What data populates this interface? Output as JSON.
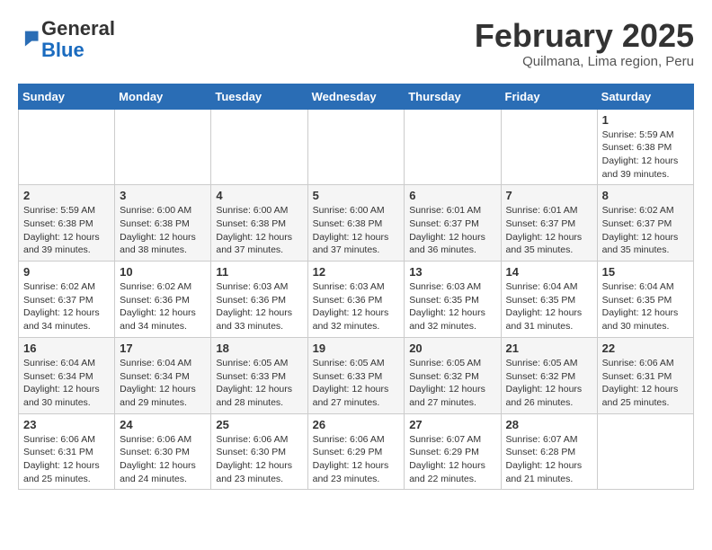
{
  "logo": {
    "general": "General",
    "blue": "Blue"
  },
  "header": {
    "month": "February 2025",
    "location": "Quilmana, Lima region, Peru"
  },
  "weekdays": [
    "Sunday",
    "Monday",
    "Tuesday",
    "Wednesday",
    "Thursday",
    "Friday",
    "Saturday"
  ],
  "weeks": [
    [
      {
        "day": "",
        "info": ""
      },
      {
        "day": "",
        "info": ""
      },
      {
        "day": "",
        "info": ""
      },
      {
        "day": "",
        "info": ""
      },
      {
        "day": "",
        "info": ""
      },
      {
        "day": "",
        "info": ""
      },
      {
        "day": "1",
        "info": "Sunrise: 5:59 AM\nSunset: 6:38 PM\nDaylight: 12 hours and 39 minutes."
      }
    ],
    [
      {
        "day": "2",
        "info": "Sunrise: 5:59 AM\nSunset: 6:38 PM\nDaylight: 12 hours and 39 minutes."
      },
      {
        "day": "3",
        "info": "Sunrise: 6:00 AM\nSunset: 6:38 PM\nDaylight: 12 hours and 38 minutes."
      },
      {
        "day": "4",
        "info": "Sunrise: 6:00 AM\nSunset: 6:38 PM\nDaylight: 12 hours and 37 minutes."
      },
      {
        "day": "5",
        "info": "Sunrise: 6:00 AM\nSunset: 6:38 PM\nDaylight: 12 hours and 37 minutes."
      },
      {
        "day": "6",
        "info": "Sunrise: 6:01 AM\nSunset: 6:37 PM\nDaylight: 12 hours and 36 minutes."
      },
      {
        "day": "7",
        "info": "Sunrise: 6:01 AM\nSunset: 6:37 PM\nDaylight: 12 hours and 35 minutes."
      },
      {
        "day": "8",
        "info": "Sunrise: 6:02 AM\nSunset: 6:37 PM\nDaylight: 12 hours and 35 minutes."
      }
    ],
    [
      {
        "day": "9",
        "info": "Sunrise: 6:02 AM\nSunset: 6:37 PM\nDaylight: 12 hours and 34 minutes."
      },
      {
        "day": "10",
        "info": "Sunrise: 6:02 AM\nSunset: 6:36 PM\nDaylight: 12 hours and 34 minutes."
      },
      {
        "day": "11",
        "info": "Sunrise: 6:03 AM\nSunset: 6:36 PM\nDaylight: 12 hours and 33 minutes."
      },
      {
        "day": "12",
        "info": "Sunrise: 6:03 AM\nSunset: 6:36 PM\nDaylight: 12 hours and 32 minutes."
      },
      {
        "day": "13",
        "info": "Sunrise: 6:03 AM\nSunset: 6:35 PM\nDaylight: 12 hours and 32 minutes."
      },
      {
        "day": "14",
        "info": "Sunrise: 6:04 AM\nSunset: 6:35 PM\nDaylight: 12 hours and 31 minutes."
      },
      {
        "day": "15",
        "info": "Sunrise: 6:04 AM\nSunset: 6:35 PM\nDaylight: 12 hours and 30 minutes."
      }
    ],
    [
      {
        "day": "16",
        "info": "Sunrise: 6:04 AM\nSunset: 6:34 PM\nDaylight: 12 hours and 30 minutes."
      },
      {
        "day": "17",
        "info": "Sunrise: 6:04 AM\nSunset: 6:34 PM\nDaylight: 12 hours and 29 minutes."
      },
      {
        "day": "18",
        "info": "Sunrise: 6:05 AM\nSunset: 6:33 PM\nDaylight: 12 hours and 28 minutes."
      },
      {
        "day": "19",
        "info": "Sunrise: 6:05 AM\nSunset: 6:33 PM\nDaylight: 12 hours and 27 minutes."
      },
      {
        "day": "20",
        "info": "Sunrise: 6:05 AM\nSunset: 6:32 PM\nDaylight: 12 hours and 27 minutes."
      },
      {
        "day": "21",
        "info": "Sunrise: 6:05 AM\nSunset: 6:32 PM\nDaylight: 12 hours and 26 minutes."
      },
      {
        "day": "22",
        "info": "Sunrise: 6:06 AM\nSunset: 6:31 PM\nDaylight: 12 hours and 25 minutes."
      }
    ],
    [
      {
        "day": "23",
        "info": "Sunrise: 6:06 AM\nSunset: 6:31 PM\nDaylight: 12 hours and 25 minutes."
      },
      {
        "day": "24",
        "info": "Sunrise: 6:06 AM\nSunset: 6:30 PM\nDaylight: 12 hours and 24 minutes."
      },
      {
        "day": "25",
        "info": "Sunrise: 6:06 AM\nSunset: 6:30 PM\nDaylight: 12 hours and 23 minutes."
      },
      {
        "day": "26",
        "info": "Sunrise: 6:06 AM\nSunset: 6:29 PM\nDaylight: 12 hours and 23 minutes."
      },
      {
        "day": "27",
        "info": "Sunrise: 6:07 AM\nSunset: 6:29 PM\nDaylight: 12 hours and 22 minutes."
      },
      {
        "day": "28",
        "info": "Sunrise: 6:07 AM\nSunset: 6:28 PM\nDaylight: 12 hours and 21 minutes."
      },
      {
        "day": "",
        "info": ""
      }
    ]
  ]
}
